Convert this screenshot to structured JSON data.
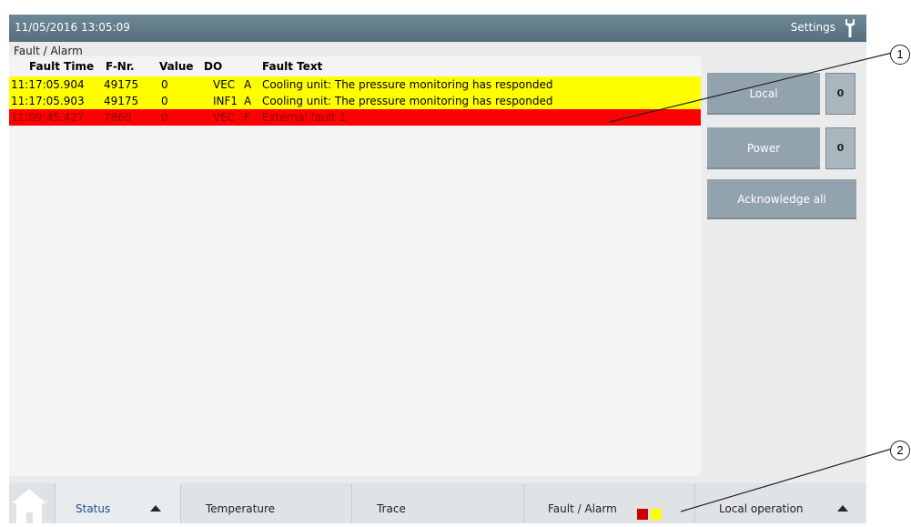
{
  "header": {
    "datetime": "11/05/2016 13:05:09",
    "settings_label": "Settings"
  },
  "breadcrumb": "Fault / Alarm",
  "table": {
    "columns": [
      "Fault Time",
      "F-Nr.",
      "Value",
      "DO",
      "Fault Text"
    ],
    "rows": [
      {
        "time": "11:17:05.904",
        "fnr": "49175",
        "value": "0",
        "do": "VEC",
        "type": "A",
        "text": "Cooling unit: The pressure monitoring has responded",
        "color": "#ffff00"
      },
      {
        "time": "11:17:05.903",
        "fnr": "49175",
        "value": "0",
        "do": "INF1",
        "type": "A",
        "text": "Cooling unit: The pressure monitoring has responded",
        "color": "#ffff00"
      },
      {
        "time": "11:09:45.427",
        "fnr": "7860",
        "value": "0",
        "do": "VEC",
        "type": "F",
        "text": "External fault 1",
        "color": "#ff0000"
      }
    ]
  },
  "buttons": {
    "local": "Local",
    "local_state": "0",
    "power": "Power",
    "power_state": "0",
    "ack_all": "Acknowledge all"
  },
  "nav": {
    "status": "Status",
    "temperature": "Temperature",
    "trace": "Trace",
    "fault_alarm": "Fault / Alarm",
    "local_operation": "Local operation",
    "indicator_colors": [
      "#cc0000",
      "#ffff00"
    ]
  },
  "callouts": [
    "1",
    "2"
  ]
}
